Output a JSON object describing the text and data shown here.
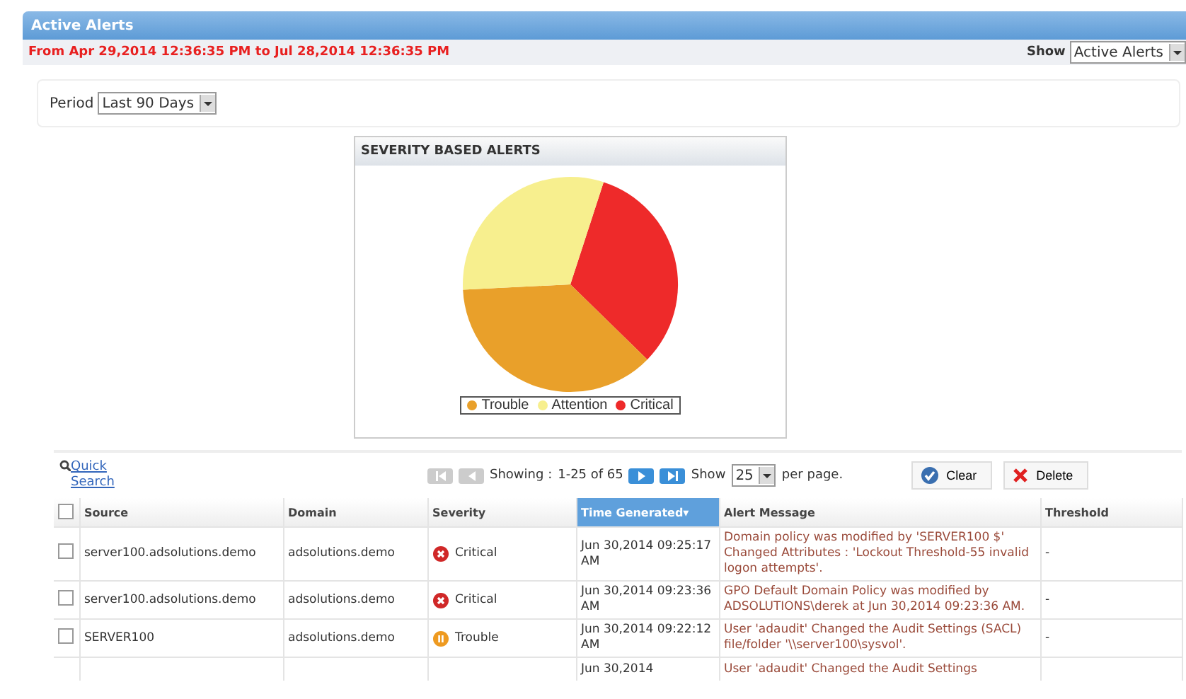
{
  "window": {
    "title": "Active Alerts"
  },
  "date_range": "From Apr 29,2014 12:36:35 PM to Jul 28,2014 12:36:35 PM",
  "show_filter": {
    "label": "Show",
    "value": "Active Alerts"
  },
  "period": {
    "label": "Period",
    "value": "Last 90 Days"
  },
  "chart": {
    "title": "SEVERITY BASED ALERTS",
    "legend": [
      {
        "name": "Trouble",
        "color": "#e9a02a"
      },
      {
        "name": "Attention",
        "color": "#f7ef8e"
      },
      {
        "name": "Critical",
        "color": "#ee2a2a"
      }
    ]
  },
  "toolbar": {
    "quick_search": "Quick Search",
    "showing_label": "Showing :",
    "showing_range": "1-25 of 65",
    "show_label": "Show",
    "page_size": "25",
    "per_page": "per page.",
    "buttons": [
      {
        "label": "Clear",
        "kind": "clear"
      },
      {
        "label": "Delete",
        "kind": "delete"
      }
    ]
  },
  "table": {
    "select_all": false,
    "columns": [
      {
        "label": "Source",
        "sorted": false
      },
      {
        "label": "Domain",
        "sorted": false
      },
      {
        "label": "Severity",
        "sorted": false
      },
      {
        "label": "Time Generated▾",
        "sorted": true
      },
      {
        "label": "Alert Message",
        "sorted": false
      },
      {
        "label": "Threshold",
        "sorted": false
      }
    ],
    "rows": [
      {
        "checked": false,
        "source": "server100.adsolutions.demo",
        "domain": "adsolutions.demo",
        "severity": "Critical",
        "kind": "critical",
        "time": "Jun 30,2014 09:25:17 AM",
        "message": "Domain policy was modified by 'SERVER100 $' Changed Attributes : 'Lockout Threshold-55 invalid logon attempts'.",
        "threshold": "-"
      },
      {
        "checked": false,
        "source": "server100.adsolutions.demo",
        "domain": "adsolutions.demo",
        "severity": "Critical",
        "kind": "critical",
        "time": "Jun 30,2014 09:23:36 AM",
        "message": "GPO Default Domain Policy was modified by ADSOLUTIONS\\derek at Jun 30,2014 09:23:36 AM.",
        "threshold": "-"
      },
      {
        "checked": false,
        "source": "SERVER100",
        "domain": "adsolutions.demo",
        "severity": "Trouble",
        "kind": "trouble",
        "time": "Jun 30,2014 09:22:12 AM",
        "message": "User 'adaudit' Changed the Audit Settings (SACL) file/folder '\\\\server100\\sysvol'.",
        "threshold": "-"
      },
      {
        "time": "Jun 30,2014",
        "message": "User 'adaudit' Changed the Audit Settings"
      }
    ]
  }
}
